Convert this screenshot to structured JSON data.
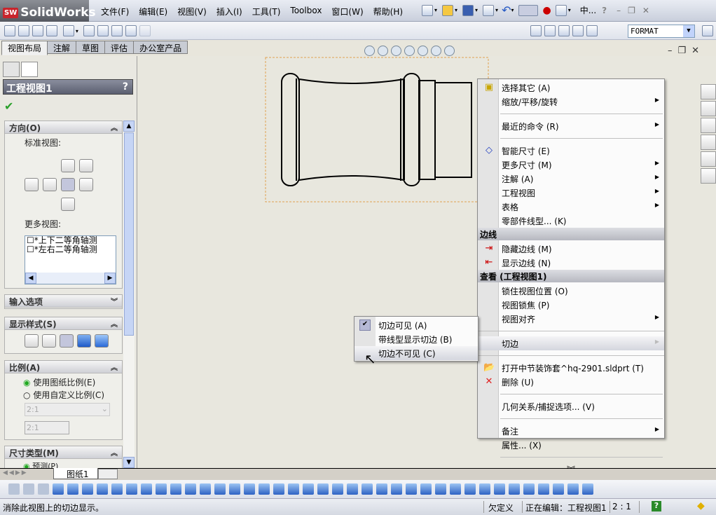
{
  "app": {
    "title": "SolidWorks",
    "logo_badge": "SW"
  },
  "menubar": [
    "文件(F)",
    "编辑(E)",
    "视图(V)",
    "插入(I)",
    "工具(T)",
    "Toolbox",
    "窗口(W)",
    "帮助(H)"
  ],
  "topright": {
    "doc_label": "中...",
    "help": "?"
  },
  "layer_combo": {
    "value": "FORMAT"
  },
  "tabs": [
    {
      "label": "视图布局",
      "active": true
    },
    {
      "label": "注解"
    },
    {
      "label": "草图"
    },
    {
      "label": "评估"
    },
    {
      "label": "办公室产品"
    }
  ],
  "property_manager": {
    "title": "工程视图1",
    "help": "?",
    "orientation": {
      "title": "方向(O)",
      "standard_views": "标准视图:",
      "more_views": "更多视图:",
      "more_views_list": [
        "*上下二等角轴测",
        "*左右二等角轴测"
      ]
    },
    "import_options": {
      "title": "输入选项"
    },
    "display_style": {
      "title": "显示样式(S)",
      "selected_index": 2
    },
    "scale": {
      "title": "比例(A)",
      "options": [
        {
          "label": "使用图纸比例(E)",
          "checked": true
        },
        {
          "label": "使用自定义比例(C)",
          "checked": false
        }
      ],
      "combo_value": "2:1",
      "input_value": "2:1"
    },
    "dimension_type": {
      "title": "尺寸类型(M)",
      "option": "预测(P)"
    }
  },
  "context_menu": {
    "items": [
      {
        "type": "item",
        "label": "选择其它 (A)",
        "icon": "select-other-icon"
      },
      {
        "type": "item",
        "label": "缩放/平移/旋转",
        "sub": true
      },
      {
        "type": "sep"
      },
      {
        "type": "item",
        "label": "最近的命令 (R)",
        "sub": true
      },
      {
        "type": "sep"
      },
      {
        "type": "item",
        "label": "智能尺寸 (E)",
        "icon": "smart-dimension-icon"
      },
      {
        "type": "item",
        "label": "更多尺寸 (M)",
        "sub": true
      },
      {
        "type": "item",
        "label": "注解 (A)",
        "sub": true
      },
      {
        "type": "item",
        "label": "工程视图",
        "sub": true
      },
      {
        "type": "item",
        "label": "表格",
        "sub": true
      },
      {
        "type": "item",
        "label": "零部件线型... (K)"
      },
      {
        "type": "header",
        "label": "边线"
      },
      {
        "type": "item",
        "label": "隐藏边线 (M)",
        "icon": "hide-edge-icon"
      },
      {
        "type": "item",
        "label": "显示边线 (N)",
        "icon": "show-edge-icon"
      },
      {
        "type": "header",
        "label": "查看 (工程视图1)"
      },
      {
        "type": "item",
        "label": "锁住视图位置 (O)"
      },
      {
        "type": "item",
        "label": "视图锁焦 (P)"
      },
      {
        "type": "item",
        "label": "视图对齐",
        "sub": true
      },
      {
        "type": "sepfull"
      },
      {
        "type": "item",
        "label": "切边",
        "sub": true,
        "highlighted": true
      },
      {
        "type": "sepfull"
      },
      {
        "type": "item",
        "label": "打开中节装饰套^hq-2901.sldprt (T)",
        "icon": "open-folder-icon"
      },
      {
        "type": "item",
        "label": "删除 (U)",
        "icon": "delete-icon"
      },
      {
        "type": "sep"
      },
      {
        "type": "item",
        "label": "几何关系/捕捉选项... (V)"
      },
      {
        "type": "sep"
      },
      {
        "type": "item",
        "label": "备注",
        "sub": true
      },
      {
        "type": "item",
        "label": "属性... (X)"
      },
      {
        "type": "sep"
      },
      {
        "type": "expand",
        "label": "»"
      }
    ]
  },
  "tangent_submenu": [
    {
      "label": "切边可见 (A)",
      "checked": true
    },
    {
      "label": "带线型显示切边 (B)"
    },
    {
      "label": "切边不可见 (C)",
      "highlighted": true
    }
  ],
  "sheet_tab": "图纸1",
  "statusbar": {
    "message": "消除此视图上的切边显示。",
    "state": "欠定义",
    "editing": "正在编辑：工程视图1",
    "scale": "2 : 1",
    "help": "?"
  }
}
